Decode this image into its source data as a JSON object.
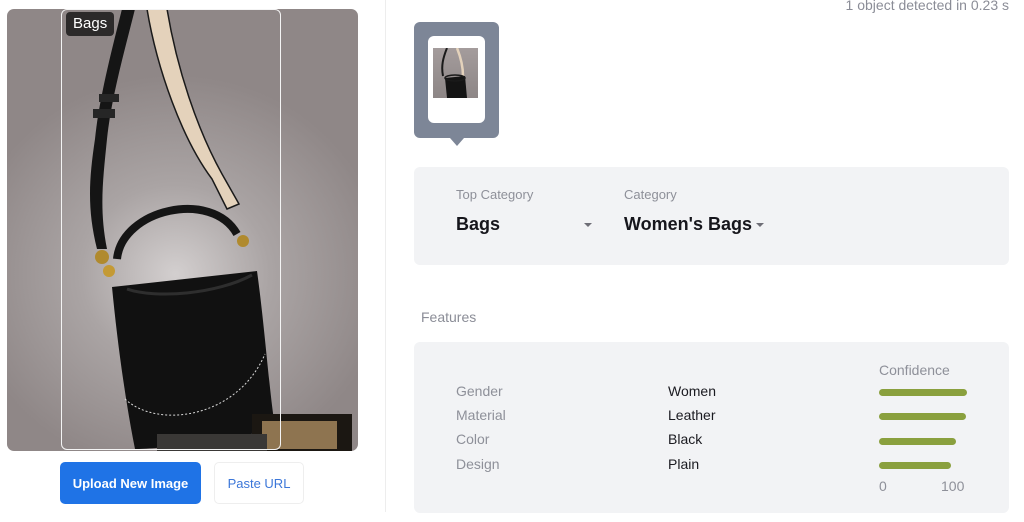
{
  "detection": {
    "status_text": "1 object detected in 0.23 s",
    "box_label": "Bags"
  },
  "actions": {
    "upload_label": "Upload New Image",
    "paste_label": "Paste URL"
  },
  "categories": {
    "top_category_label": "Top Category",
    "top_category_value": "Bags",
    "category_label": "Category",
    "category_value": "Women's Bags"
  },
  "features": {
    "title": "Features",
    "confidence_label": "Confidence",
    "axis_min": "0",
    "axis_max": "100",
    "items": [
      {
        "name": "Gender",
        "value": "Women",
        "confidence": 100
      },
      {
        "name": "Material",
        "value": "Leather",
        "confidence": 99
      },
      {
        "name": "Color",
        "value": "Black",
        "confidence": 88
      },
      {
        "name": "Design",
        "value": "Plain",
        "confidence": 82
      }
    ]
  },
  "colors": {
    "primary": "#1f73e6",
    "confidence_bar": "#8aa03e",
    "panel_bg": "#f2f3f5",
    "thumb_frame": "#7d8697"
  }
}
